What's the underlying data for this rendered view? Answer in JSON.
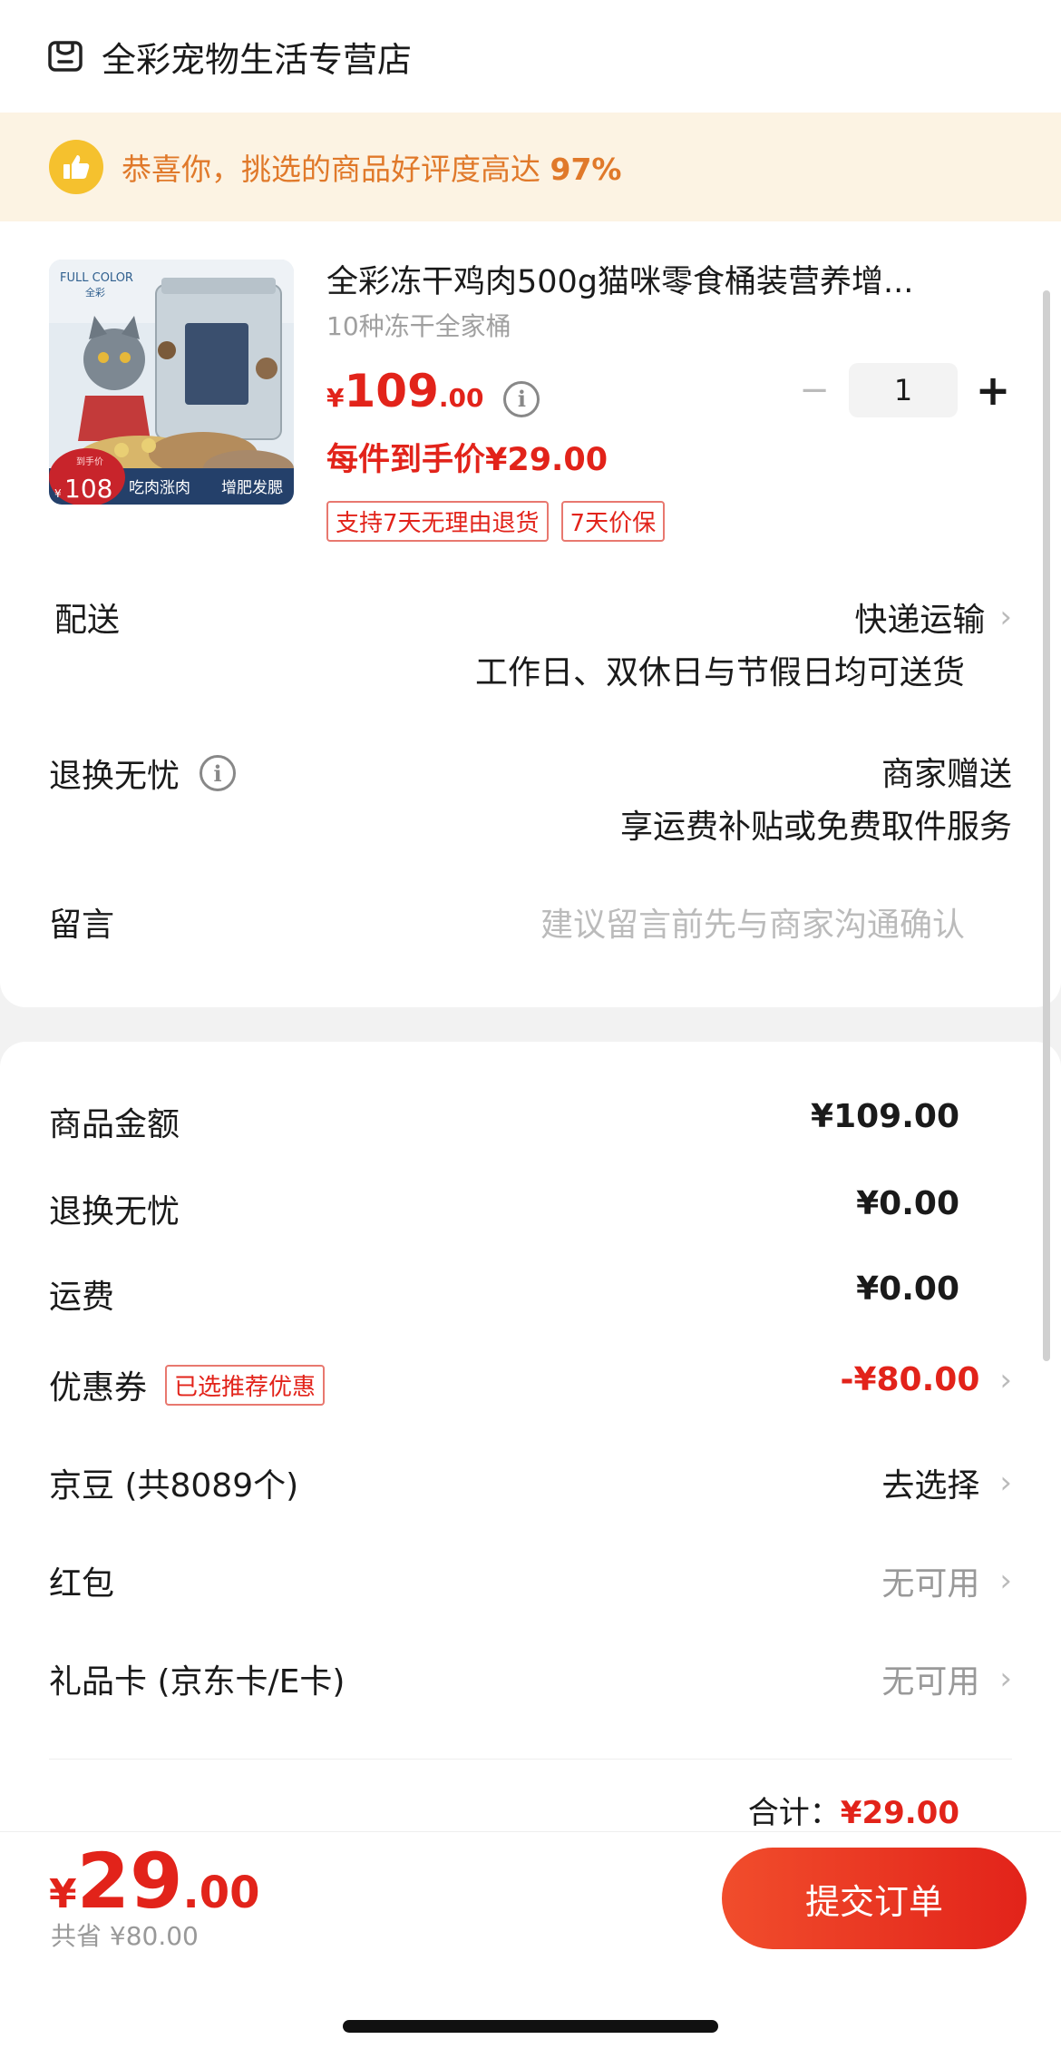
{
  "store": {
    "name": "全彩宠物生活专营店",
    "icon": "store-icon"
  },
  "banner": {
    "text": "恭喜你，挑选的商品好评度高达",
    "percent": "97%",
    "icon": "thumbs-up-icon"
  },
  "product": {
    "title": "全彩冻干鸡肉500g猫咪零食桶装营养增...",
    "subtitle": "10种冻干全家桶",
    "price_currency": "¥",
    "price_int": "109",
    "price_dec": ".00",
    "quantity": "1",
    "hand_price": "每件到手价¥29.00",
    "tags": [
      "支持7天无理由退货",
      "7天价保"
    ],
    "image": {
      "brand": "FULL COLOR",
      "brand_cn": "全彩",
      "badge_label": "到手价",
      "badge_price": "108",
      "badge_currency": "¥",
      "caption1": "吃肉涨肉",
      "caption2": "增肥发腮"
    }
  },
  "delivery": {
    "label": "配送",
    "method": "快递运输",
    "detail": "工作日、双休日与节假日均可送货"
  },
  "worry_free": {
    "label": "退换无忧",
    "value": "商家赠送",
    "detail": "享运费补贴或免费取件服务"
  },
  "message": {
    "label": "留言",
    "placeholder": "建议留言前先与商家沟通确认"
  },
  "summary": {
    "goods_amount": {
      "label": "商品金额",
      "value": "¥109.00"
    },
    "worry_free": {
      "label": "退换无忧",
      "value": "¥0.00"
    },
    "shipping": {
      "label": "运费",
      "value": "¥0.00"
    },
    "coupon": {
      "label": "优惠券",
      "tag": "已选推荐优惠",
      "value": "-¥80.00"
    },
    "jingdou": {
      "label": "京豆 (共8089个)",
      "value": "去选择"
    },
    "red_packet": {
      "label": "红包",
      "value": "无可用"
    },
    "gift_card": {
      "label": "礼品卡 (京东卡/E卡)",
      "value": "无可用"
    },
    "total_label": "合计：",
    "total_value": "¥29.00"
  },
  "bottom": {
    "currency": "¥",
    "amount_int": "29",
    "amount_dec": ".00",
    "saved": "共省 ¥80.00",
    "submit_label": "提交订单"
  },
  "colors": {
    "accent": "#e2231a",
    "banner_bg": "#fcf3e3",
    "banner_text": "#e0792a"
  }
}
